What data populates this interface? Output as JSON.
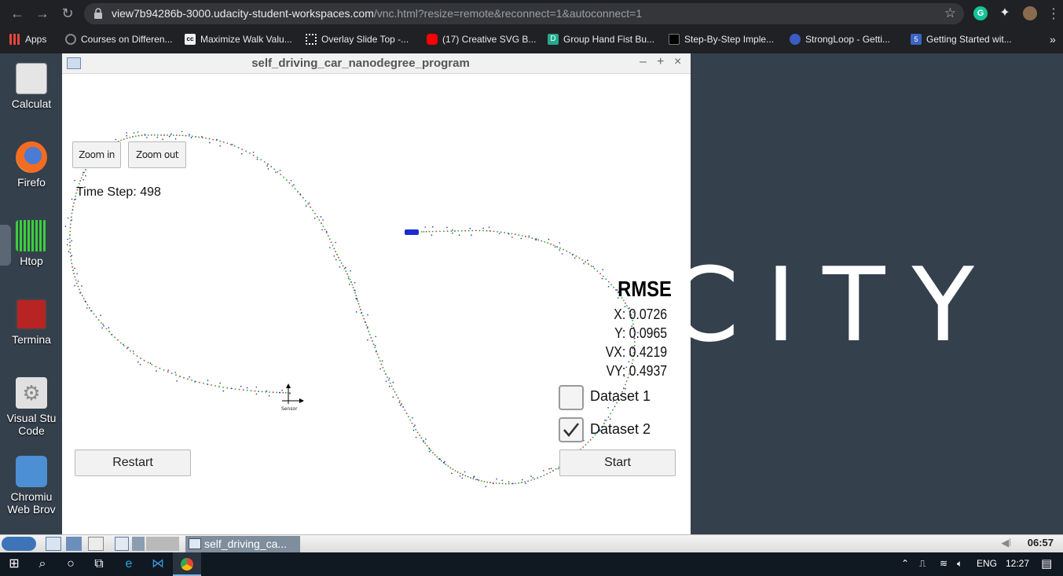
{
  "browser": {
    "url_host": "view7b94286b-3000.udacity-student-workspaces.com",
    "url_path": "/vnc.html?resize=remote&reconnect=1&autoconnect=1",
    "bookmarks": [
      {
        "label": "Apps",
        "icon": "apps-grid-icon",
        "color": "#e8453c"
      },
      {
        "label": "Courses on Differen...",
        "icon": "circle-icon",
        "color": "#444"
      },
      {
        "label": "Maximize Walk Valu...",
        "icon": "cc-icon",
        "color": "#f2f2f2"
      },
      {
        "label": "Overlay Slide Top -...",
        "icon": "codrops-icon",
        "color": "#fff"
      },
      {
        "label": "(17) Creative SVG B...",
        "icon": "youtube-icon",
        "color": "#ff0000"
      },
      {
        "label": "Group Hand Fist Bu...",
        "icon": "d-icon",
        "color": "#23a98b"
      },
      {
        "label": "Step-By-Step Imple...",
        "icon": "black-square-icon",
        "color": "#000"
      },
      {
        "label": "StrongLoop - Getti...",
        "icon": "strongloop-icon",
        "color": "#3b5cc4"
      },
      {
        "label": "Getting Started wit...",
        "icon": "html5-icon",
        "color": "#3b64c4"
      }
    ],
    "more_bookmarks": "»"
  },
  "desktop": {
    "icons": [
      {
        "label": "Calculat",
        "icon": "calculator-icon"
      },
      {
        "label": "Firefo",
        "icon": "firefox-icon"
      },
      {
        "label": "Htop",
        "icon": "htop-icon"
      },
      {
        "label": "Termina",
        "icon": "terminal-icon"
      },
      {
        "label": "Visual Stu Code",
        "icon": "gear-icon"
      },
      {
        "label": "Chromiu Web Brov",
        "icon": "chromium-icon"
      }
    ],
    "background_logo": "CITY"
  },
  "window": {
    "title": "self_driving_car_nanodegree_program",
    "minimize": "–",
    "maximize": "+",
    "close": "×"
  },
  "sim": {
    "zoom_in": "Zoom in",
    "zoom_out": "Zoom out",
    "time_step": "Time Step: 498",
    "rmse_title": "RMSE",
    "rmse_x": "X: 0.0726",
    "rmse_y": "Y: 0.0965",
    "rmse_vx": "VX: 0.4219",
    "rmse_vy": "VY: 0.4937",
    "dataset1": "Dataset 1",
    "dataset1_checked": false,
    "dataset2": "Dataset 2",
    "dataset2_checked": true,
    "restart": "Restart",
    "start": "Start",
    "sensor_label": "Sensor"
  },
  "lx_panel": {
    "task_label": "self_driving_ca...",
    "clock": "06:57"
  },
  "taskbar": {
    "lang": "ENG",
    "time": "12:27"
  },
  "colors": {
    "accent": "#1a73e8",
    "track_green": "#2a9d2a",
    "track_red": "#d23030",
    "track_blue": "#1b2bd0"
  }
}
